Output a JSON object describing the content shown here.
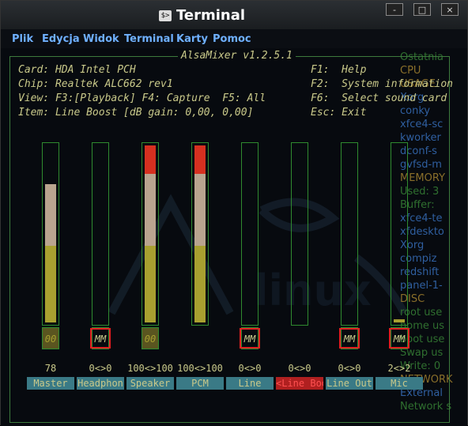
{
  "window": {
    "title": "Terminal",
    "icon": "terminal-icon",
    "buttons": [
      "-",
      "□",
      "×"
    ]
  },
  "menu": [
    "Plik",
    "Edycja",
    "Widok",
    "Terminal",
    "Karty",
    "Pomoc"
  ],
  "alsamixer": {
    "title": "AlsaMixer v1.2.5.1",
    "card": "Card: HDA Intel PCH",
    "chip": "Chip: Realtek ALC662 rev1",
    "view": "View: F3:[Playback] F4: Capture  F5: All",
    "item": "Item: Line Boost [dB gain: 0,00, 0,00]",
    "help1": "F1:  Help",
    "help2": "F2:  System information",
    "help3": "F6:  Select sound card",
    "help4": "Esc: Exit",
    "channels": [
      {
        "name": "Master",
        "value": "78",
        "level": 0.78,
        "mute": "00",
        "selected": false,
        "mute_highlight": false
      },
      {
        "name": "Headphon",
        "value": "0<>0",
        "level": 0,
        "mute": "MM",
        "selected": false,
        "mute_highlight": true
      },
      {
        "name": "Speaker",
        "value": "100<>100",
        "level": 1.0,
        "mute": "00",
        "selected": false,
        "mute_highlight": false
      },
      {
        "name": "PCM",
        "value": "100<>100",
        "level": 1.0,
        "mute": "",
        "selected": false,
        "mute_highlight": false
      },
      {
        "name": "Line",
        "value": "0<>0",
        "level": 0,
        "mute": "MM",
        "selected": false,
        "mute_highlight": true
      },
      {
        "name": "<Line Boo>",
        "value": "0<>0",
        "level": 0,
        "mute": "",
        "selected": true,
        "mute_highlight": false
      },
      {
        "name": "Line Out",
        "value": "0<>0",
        "level": 0,
        "mute": "MM",
        "selected": false,
        "mute_highlight": true
      },
      {
        "name": "Mic",
        "value": "2<>2",
        "level": 0.02,
        "mute": "MM",
        "selected": false,
        "mute_highlight": true
      }
    ]
  },
  "conky": {
    "lines": [
      {
        "text": "Ostatnia",
        "color": "#2f6f2f"
      },
      {
        "text": "CPU",
        "color": "#8a6f2a"
      },
      {
        "text": "USAGE",
        "color": "#8a6f2a"
      },
      {
        "text": "Xorg",
        "color": "#2f5fa0"
      },
      {
        "text": "conky",
        "color": "#2f5fa0"
      },
      {
        "text": "xfce4-sc",
        "color": "#2f5fa0"
      },
      {
        "text": "kworker",
        "color": "#2f5fa0"
      },
      {
        "text": "dconf-s",
        "color": "#2f5fa0"
      },
      {
        "text": "gvfsd-m",
        "color": "#2f5fa0"
      },
      {
        "text": "MEMORY",
        "color": "#8a6f2a"
      },
      {
        "text": "Used: 3",
        "color": "#2f6f2f"
      },
      {
        "text": "Buffer:",
        "color": "#2f6f2f"
      },
      {
        "text": "xfce4-te",
        "color": "#2f5fa0"
      },
      {
        "text": "xfdeskto",
        "color": "#2f5fa0"
      },
      {
        "text": "Xorg",
        "color": "#2f5fa0"
      },
      {
        "text": "compiz",
        "color": "#2f5fa0"
      },
      {
        "text": "redshift",
        "color": "#2f5fa0"
      },
      {
        "text": "panel-1-",
        "color": "#2f5fa0"
      },
      {
        "text": "DISC",
        "color": "#8a6f2a"
      },
      {
        "text": "root use",
        "color": "#2f6f2f"
      },
      {
        "text": "home us",
        "color": "#2f6f2f"
      },
      {
        "text": "boot use",
        "color": "#2f6f2f"
      },
      {
        "text": "Swap us",
        "color": "#2f6f2f"
      },
      {
        "text": "Write: 0",
        "color": "#2f6f2f"
      },
      {
        "text": "NETWORK",
        "color": "#8a6f2a"
      },
      {
        "text": "External",
        "color": "#2f5fa0"
      },
      {
        "text": "Network s",
        "color": "#2f6f2f"
      }
    ]
  },
  "colors": {
    "low": "#a8a030",
    "mid": "#b9a48f",
    "high": "#d53020",
    "frame": "#2f8a2f",
    "label_bg": "#3a7a86",
    "menu_text": "#6fb0ff"
  }
}
